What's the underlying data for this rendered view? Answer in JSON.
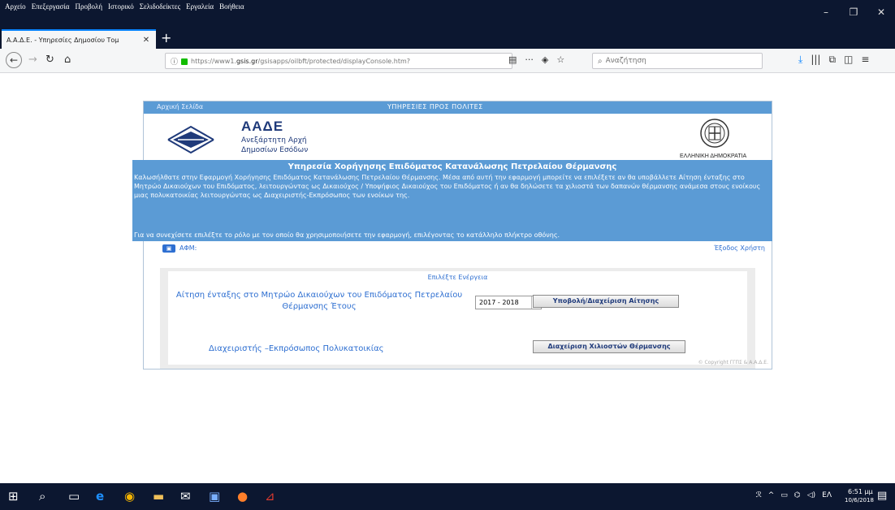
{
  "browser": {
    "menu": [
      "Αρχείο",
      "Επεξεργασία",
      "Προβολή",
      "Ιστορικό",
      "Σελιδοδείκτες",
      "Εργαλεία",
      "Βοήθεια"
    ],
    "tab_title": "Α.Α.Δ.Ε. - Υπηρεσίες Δημοσίου Τομ",
    "url_prefix": "https://www1.",
    "url_domain": "gsis.gr",
    "url_path": "/gsisapps/oilbft/protected/displayConsole.htm?",
    "search_placeholder": "Αναζήτηση"
  },
  "page": {
    "home_link": "Αρχική Σελίδα",
    "top_title": "ΥΠΗΡΕΣΙΕΣ ΠΡΟΣ ΠΟΛΙΤΕΣ",
    "logo_name": "ΑΑΔΕ",
    "logo_sub1": "Ανεξάρτητη Αρχή",
    "logo_sub2": "Δημοσίων Εσόδων",
    "hellenic": "ΕΛΛΗΝΙΚΗ ΔΗΜΟΚΡΑΤΙΑ",
    "service_title": "Υπηρεσία Χορήγησης Επιδόματος Κατανάλωσης Πετρελαίου Θέρμανσης",
    "welcome": "Καλωσήλθατε στην Εφαρμογή Χορήγησης Επιδόματος Κατανάλωσης Πετρελαίου Θέρμανσης. Μέσα από αυτή την εφαρμογή μπορείτε να επιλέξετε αν θα υποβάλλετε Αίτηση ένταξης στο Μητρώο Δικαιούχων του Επιδόματος, λειτουργώντας ως Δικαιούχος / Υποψήφιος Δικαιούχος του Επιδόματος ή αν θα δηλώσετε τα χιλιοστά των δαπανών θέρμανσης ανάμεσα στους ενοίκους μιας πολυκατοικίας λειτουργώντας ως Διαχειριστής-Εκπρόσωπος των ενοίκων της.",
    "instruction": "Για να συνεχίσετε επιλέξτε το ρόλο με τον οποίο θα χρησιμοποιήσετε την εφαρμογή, επιλέγοντας το κατάλληλο πλήκτρο οθόνης.",
    "afm_label": "ΑΦΜ:",
    "logout": "Έξοδος Χρήστη",
    "action_head": "Επιλέξτε Ενέργεια",
    "row1_label": "Αίτηση ένταξης στο Μητρώο Δικαιούχων του Επιδόματος Πετρελαίου Θέρμανσης Έτους",
    "year": "2017 - 2018",
    "btn_submit": "Υποβολή/Διαχείριση Αίτησης",
    "row2_label": "Διαχειριστής –Εκπρόσωπος Πολυκατοικίας",
    "btn_thousandths": "Διαχείριση Χιλιοστών Θέρμανσης",
    "copyright": "© Copyright ΓΓΠΣ & Α.Α.Δ.Ε."
  },
  "taskbar": {
    "lang": "ΕΛ",
    "time": "6:51 μμ",
    "date": "10/6/2018"
  }
}
